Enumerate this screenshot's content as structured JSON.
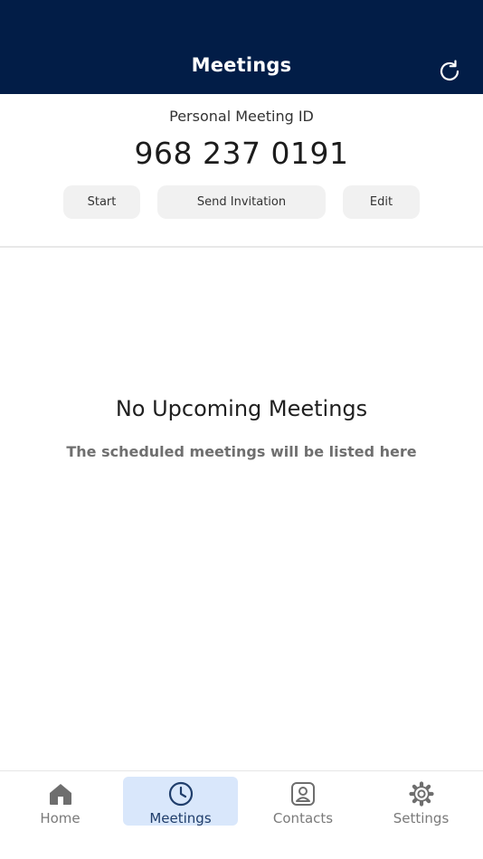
{
  "header": {
    "title": "Meetings",
    "refresh_icon": "refresh-icon",
    "background": "#021d47"
  },
  "pmi": {
    "label": "Personal Meeting ID",
    "number": "968 237 0191",
    "actions": {
      "start": "Start",
      "send_invitation": "Send Invitation",
      "edit": "Edit"
    }
  },
  "empty_state": {
    "title": "No Upcoming Meetings",
    "subtitle": "The scheduled meetings will be listed here"
  },
  "tabbar": {
    "active": "Meetings",
    "active_color": "#d9e7fb",
    "items": [
      {
        "label": "Home",
        "icon": "home-icon"
      },
      {
        "label": "Meetings",
        "icon": "clock-icon"
      },
      {
        "label": "Contacts",
        "icon": "contact-card-icon"
      },
      {
        "label": "Settings",
        "icon": "gear-icon"
      }
    ]
  }
}
